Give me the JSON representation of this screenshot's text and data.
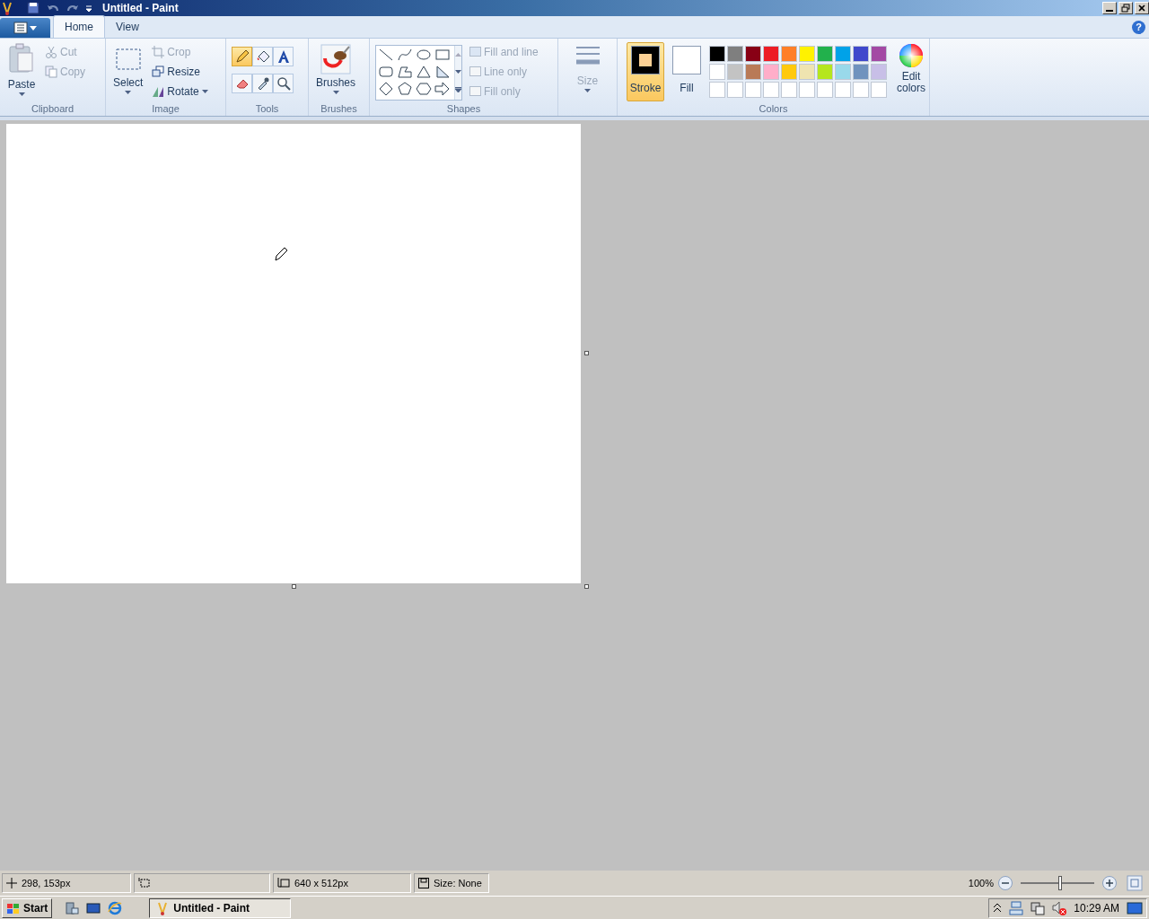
{
  "window": {
    "title": "Untitled - Paint",
    "help": "?"
  },
  "tabs": [
    {
      "label": "Home",
      "selected": true
    },
    {
      "label": "View",
      "selected": false
    }
  ],
  "clipboard": {
    "label": "Clipboard",
    "paste": "Paste",
    "cut": {
      "label": "Cut",
      "disabled": true
    },
    "copy": {
      "label": "Copy",
      "disabled": true
    }
  },
  "image": {
    "label": "Image",
    "select": "Select",
    "actions": [
      {
        "kind": "crop",
        "label": "Crop",
        "disabled": true
      },
      {
        "kind": "resize",
        "label": "Resize",
        "disabled": false
      },
      {
        "kind": "rotate",
        "label": "Rotate",
        "disabled": false
      }
    ]
  },
  "tools": {
    "label": "Tools",
    "items": [
      {
        "kind": "pencil",
        "selected": true
      },
      {
        "kind": "fill",
        "selected": false
      },
      {
        "kind": "text",
        "selected": false
      },
      {
        "kind": "eraser",
        "selected": false
      },
      {
        "kind": "picker",
        "selected": false
      },
      {
        "kind": "magnifier",
        "selected": false
      }
    ]
  },
  "brushes": {
    "label": "Brushes",
    "button": "Brushes"
  },
  "shapes": {
    "label": "Shapes",
    "options": [
      {
        "label": "Fill and line",
        "disabled": true
      },
      {
        "label": "Line only",
        "disabled": true
      },
      {
        "label": "Fill only",
        "disabled": true
      }
    ]
  },
  "size": {
    "label": "Size",
    "disabled": true
  },
  "colors": {
    "label": "Colors",
    "stroke": {
      "label": "Stroke",
      "selected": true,
      "color": "#000000"
    },
    "fill": {
      "label": "Fill",
      "selected": false,
      "color": "#ffffff"
    },
    "edit": "Edit colors",
    "palette": [
      {
        "color": "#000000"
      },
      {
        "color": "#7f7f7f"
      },
      {
        "color": "#880015"
      },
      {
        "color": "#ed1c24"
      },
      {
        "color": "#ff7f27"
      },
      {
        "color": "#fff200"
      },
      {
        "color": "#22b14c"
      },
      {
        "color": "#00a2e8"
      },
      {
        "color": "#3f48cc"
      },
      {
        "color": "#a349a4"
      },
      {
        "color": "#ffffff"
      },
      {
        "color": "#c3c3c3"
      },
      {
        "color": "#b97a57"
      },
      {
        "color": "#ffaec9"
      },
      {
        "color": "#ffc90e"
      },
      {
        "color": "#efe4b0"
      },
      {
        "color": "#b5e61d"
      },
      {
        "color": "#99d9ea"
      },
      {
        "color": "#7092be"
      },
      {
        "color": "#c8bfe7"
      },
      {
        "color": "#ffffff"
      },
      {
        "color": "#ffffff"
      },
      {
        "color": "#ffffff"
      },
      {
        "color": "#ffffff"
      },
      {
        "color": "#ffffff"
      },
      {
        "color": "#ffffff"
      },
      {
        "color": "#ffffff"
      },
      {
        "color": "#ffffff"
      },
      {
        "color": "#ffffff"
      },
      {
        "color": "#ffffff"
      }
    ]
  },
  "status_bar": {
    "position": "298, 153px",
    "canvas_size": "640 x 512px",
    "file_size": "Size: None",
    "zoom": "100%",
    "zoom_level": {
      "level": 0.55
    }
  },
  "taskbar": {
    "start": "Start",
    "tasks": [
      {
        "label": "Untitled - Paint",
        "selected": true
      }
    ],
    "clock": "10:29 AM"
  }
}
